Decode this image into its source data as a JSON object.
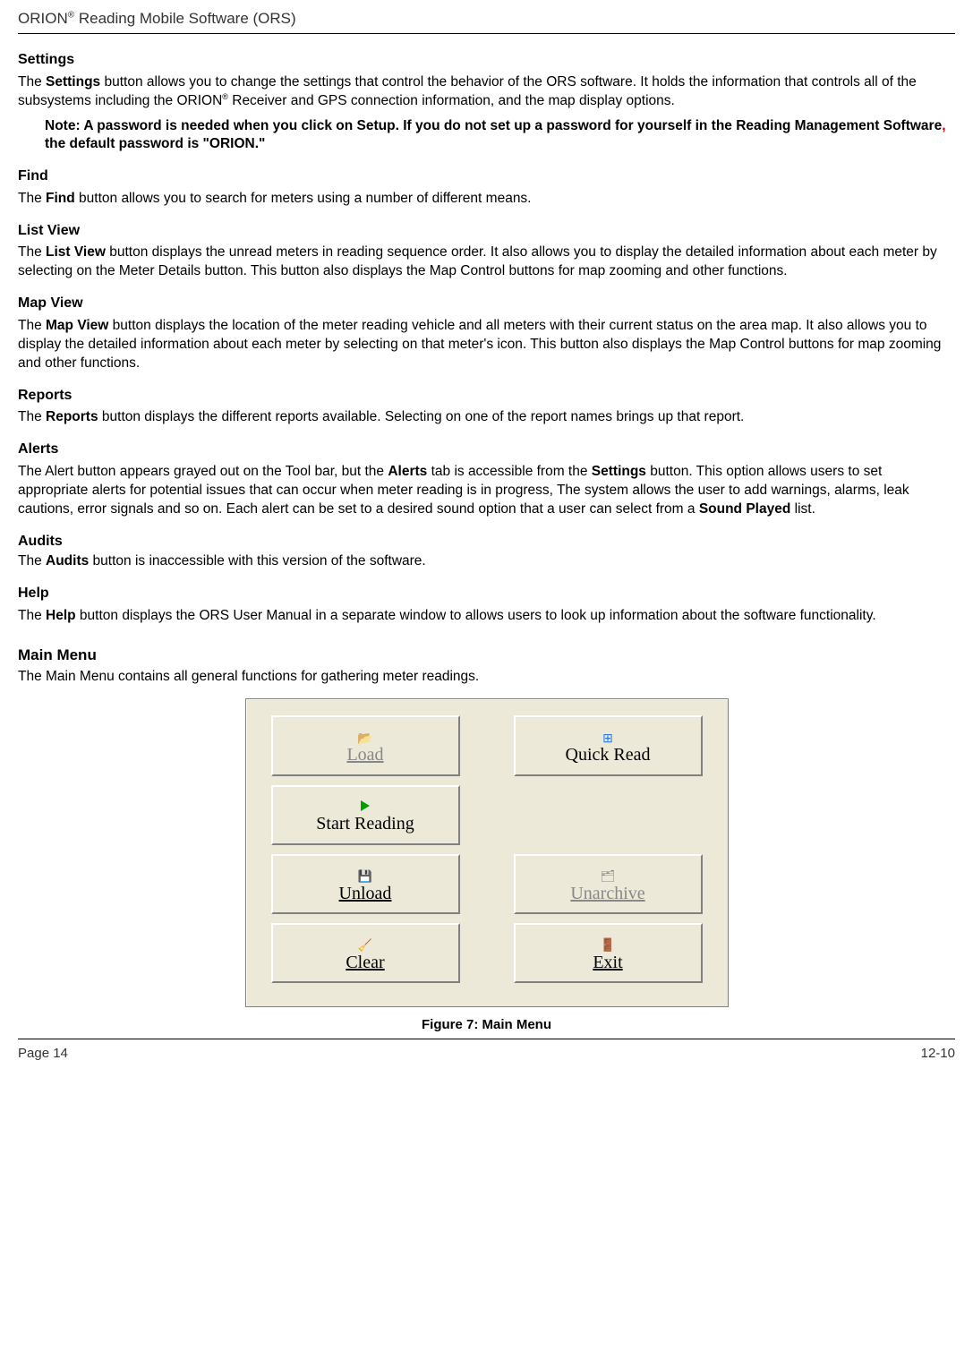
{
  "runningHead": {
    "prefix": "ORION",
    "reg": "®",
    "suffix": " Reading Mobile Software (ORS)"
  },
  "sections": {
    "settings": {
      "title": "Settings",
      "p1a": "The ",
      "p1bold": "Settings",
      "p1b": " button allows you to change the settings that control the behavior of the ORS software. It holds the information that controls all of the subsystems including the ORION",
      "p1reg": "®",
      "p1c": " Receiver and GPS connection information, and the map display options.",
      "noteA": "Note: A password is needed when you click on Setup. If you do not set up a password for yourself in the Reading Management Software",
      "noteComma": ",",
      "noteB": " the default password is \"ORION.\""
    },
    "find": {
      "title": "Find",
      "pA": "The ",
      "pBold": "Find",
      "pB": " button allows you to search for meters using a number of different means."
    },
    "listview": {
      "title": "List View",
      "pA": "The ",
      "pBold": "List View",
      "pB": " button displays the unread meters in reading sequence order. It also allows you to display the detailed information about each meter by selecting on the Meter Details button. This button also displays the Map Control buttons for map zooming and other functions."
    },
    "mapview": {
      "title": "Map View",
      "pA": "The ",
      "pBold": "Map View",
      "pB": " button displays the location of the meter reading vehicle and all meters with their current status on the area map. It also allows you to display the detailed information about each meter by selecting on that meter's icon. This button also displays the Map Control buttons for map zooming and other functions."
    },
    "reports": {
      "title": "Reports",
      "pA": "The ",
      "pBold": "Reports",
      "pB": " button displays the different reports available. Selecting on one of the report names brings up that report."
    },
    "alerts": {
      "title": "Alerts",
      "pA": "The Alert button appears grayed out on the Tool bar, but the ",
      "pBold1": "Alerts",
      "pB": " tab is accessible from the ",
      "pBold2": "Settings",
      "pC": " button.  This option allows users to set appropriate alerts for potential issues that can occur when meter reading is in progress, The system allows the user to add warnings, alarms, leak cautions, error signals and so on. Each alert can be set to a desired sound option that a user can select from a ",
      "pBold3": "Sound Played",
      "pD": " list."
    },
    "audits": {
      "title": "Audits",
      "pA": "The ",
      "pBold": "Audits",
      "pB": " button is inaccessible with this version of the software."
    },
    "help": {
      "title": "Help",
      "pA": "The ",
      "pBold": "Help",
      "pB": " button displays the ORS User Manual in a separate window to allows users to look up information about the software functionality."
    },
    "mainmenu": {
      "title": "Main Menu",
      "p": "The Main Menu contains all general functions for gathering meter readings."
    }
  },
  "buttons": {
    "load": "Load",
    "quickread": "Quick Read",
    "startreading": "Start Reading",
    "unload": "Unload",
    "unarchive": "Unarchive",
    "clear": "Clear",
    "exit": "Exit"
  },
  "figureCaption": "Figure 7: Main Menu",
  "footer": {
    "left": "Page 14",
    "right": "12-10"
  }
}
